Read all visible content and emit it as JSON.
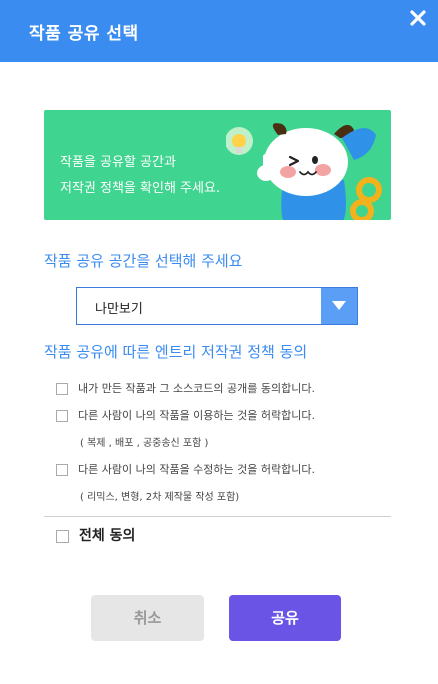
{
  "header": {
    "title": "작품 공유 선택",
    "close_icon": "close-icon"
  },
  "banner": {
    "line1": "작품을 공유할 공간과",
    "line2": "저작권 정책을 확인해 주세요.",
    "background": "#3fd48f"
  },
  "space": {
    "title": "작품 공유 공간을 선택해 주세요",
    "selected": "나만보기"
  },
  "policy": {
    "title": "작품 공유에 따른 엔트리 저작권 정책 동의",
    "items": [
      {
        "label": "내가 만든 작품과 그 소스코드의 공개를 동의합니다.",
        "checked": false
      },
      {
        "label": "다른 사람이 나의 작품을 이용하는 것을 허락합니다.",
        "note": "( 복제 , 배포 , 공중송신 포함 )",
        "checked": false
      },
      {
        "label": "다른 사람이 나의 작품을 수정하는 것을 허락합니다.",
        "note": "( 리믹스, 변형, 2차 제작물 작성 포함)",
        "checked": false
      }
    ],
    "agree_all": "전체 동의"
  },
  "buttons": {
    "cancel": "취소",
    "share": "공유"
  },
  "colors": {
    "accent": "#3a8cf1",
    "primary_button": "#6a54e5",
    "disabled_button": "#e6e6e6"
  }
}
